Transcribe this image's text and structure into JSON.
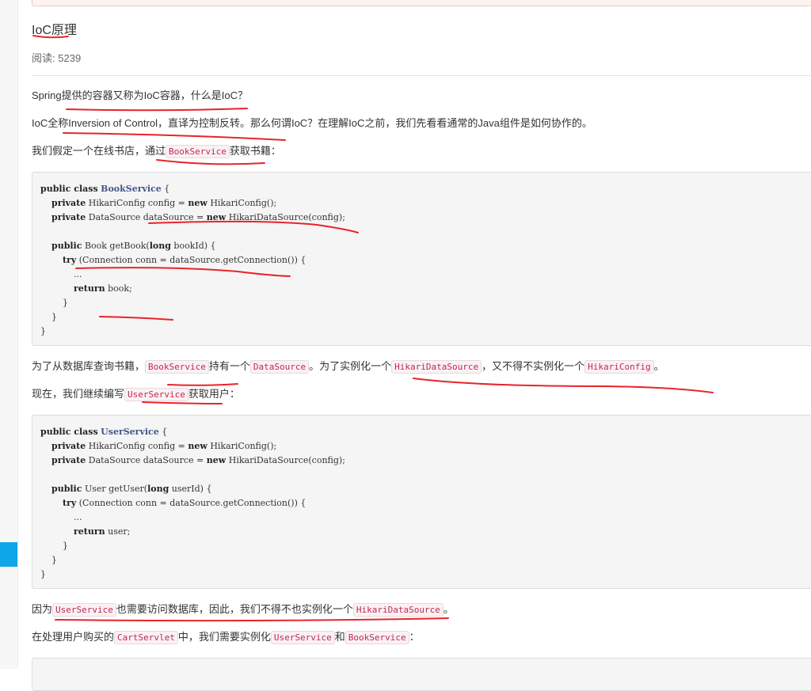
{
  "article": {
    "title": "IoC原理",
    "reads_label": "阅读:",
    "reads_count": "5239"
  },
  "paragraphs": {
    "p1": "Spring提供的容器又称为IoC容器，什么是IoC？",
    "p2": "IoC全称Inversion of Control，直译为控制反转。那么何谓IoC？在理解IoC之前，我们先看看通常的Java组件是如何协作的。",
    "p3_a": "我们假定一个在线书店，通过",
    "p3_code": "BookService",
    "p3_b": "获取书籍：",
    "p4_a": "为了从数据库查询书籍，",
    "p4_code1": "BookService",
    "p4_b": "持有一个",
    "p4_code2": "DataSource",
    "p4_c": "。为了实例化一个",
    "p4_code3": "HikariDataSource",
    "p4_d": "，又不得不实例化一个",
    "p4_code4": "HikariConfig",
    "p4_e": "。",
    "p5_a": "现在，我们继续编写",
    "p5_code": "UserService",
    "p5_b": "获取用户：",
    "p6_a": "因为",
    "p6_code1": "UserService",
    "p6_b": "也需要访问数据库，因此，我们不得不也实例化一个",
    "p6_code2": "HikariDataSource",
    "p6_c": "。",
    "p7_a": "在处理用户购买的",
    "p7_code1": "CartServlet",
    "p7_b": "中，我们需要实例化",
    "p7_code2": "UserService",
    "p7_c": "和",
    "p7_code3": "BookService",
    "p7_d": "："
  },
  "code1": {
    "l1_kw": "public class",
    "l1_name": "BookService",
    "l1_end": "{",
    "l2_kw": "private",
    "l2_rest": "HikariConfig config =",
    "l2_kw2": "new",
    "l2_end": "HikariConfig();",
    "l3_kw": "private",
    "l3_rest": "DataSource dataSource =",
    "l3_kw2": "new",
    "l3_end": "HikariDataSource(config);",
    "l5_kw": "public",
    "l5_rest": "Book getBook(",
    "l5_kw2": "long",
    "l5_end": "bookId) {",
    "l6_kw": "try",
    "l6_rest": "(Connection conn = dataSource.getConnection()) {",
    "l7": "...",
    "l8_kw": "return",
    "l8_rest": "book;",
    "l9": "}",
    "l10": "}",
    "l11": "}"
  },
  "code2": {
    "l1_kw": "public class",
    "l1_name": "UserService",
    "l1_end": "{",
    "l2_kw": "private",
    "l2_rest": "HikariConfig config =",
    "l2_kw2": "new",
    "l2_end": "HikariConfig();",
    "l3_kw": "private",
    "l3_rest": "DataSource dataSource =",
    "l3_kw2": "new",
    "l3_end": "HikariDataSource(config);",
    "l5_kw": "public",
    "l5_rest": "User getUser(",
    "l5_kw2": "long",
    "l5_end": "userId) {",
    "l6_kw": "try",
    "l6_rest": "(Connection conn = dataSource.getConnection()) {",
    "l7": "...",
    "l8_kw": "return",
    "l8_rest": "user;",
    "l9": "}",
    "l10": "}",
    "l11": "}"
  },
  "colors": {
    "annotation_red": "#e8242a",
    "inline_code": "#c7254e",
    "side_tab": "#0ea5e9"
  }
}
